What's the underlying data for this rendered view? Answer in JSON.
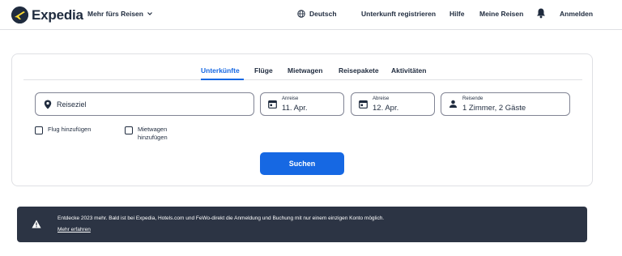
{
  "header": {
    "logo_text": "Expedia",
    "mehr_label": "Mehr fürs Reisen",
    "language_label": "Deutsch",
    "register_label": "Unterkunft registrieren",
    "help_label": "Hilfe",
    "trips_label": "Meine Reisen",
    "signin_label": "Anmelden"
  },
  "tabs": [
    {
      "label": "Unterkünfte",
      "active": true
    },
    {
      "label": "Flüge",
      "active": false
    },
    {
      "label": "Mietwagen",
      "active": false
    },
    {
      "label": "Reisepakete",
      "active": false
    },
    {
      "label": "Aktivitäten",
      "active": false
    }
  ],
  "search": {
    "destination_placeholder": "Reiseziel",
    "checkin_label": "Anreise",
    "checkin_value": "11. Apr.",
    "checkout_label": "Abreise",
    "checkout_value": "12. Apr.",
    "travelers_label": "Reisende",
    "travelers_value": "1 Zimmer, 2 Gäste",
    "add_flight_label": "Flug hinzufügen",
    "add_car_label": "Mietwagen hinzufügen",
    "submit_label": "Suchen"
  },
  "banner": {
    "text": "Entdecke 2023 mehr. Bald ist bei Expedia, Hotels.com und FeWo-direkt die Anmeldung und Buchung mit nur einem einzigen Konto möglich.",
    "link_label": "Mehr erfahren"
  },
  "colors": {
    "brand_navy": "#1f2b3e",
    "accent_blue": "#1668e3",
    "banner_bg": "#2c3444",
    "border": "#dfe0e4"
  }
}
